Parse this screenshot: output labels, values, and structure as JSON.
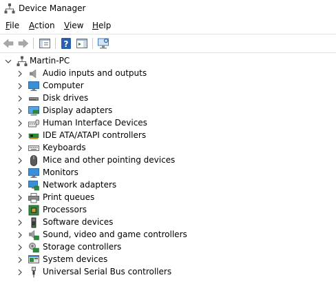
{
  "window": {
    "title": "Device Manager"
  },
  "menu": [
    {
      "key": "F",
      "rest": "ile"
    },
    {
      "key": "A",
      "rest": "ction"
    },
    {
      "key": "V",
      "rest": "iew"
    },
    {
      "key": "H",
      "rest": "elp"
    }
  ],
  "toolbar": {
    "buttons": [
      "back-icon",
      "forward-icon",
      "show-hide-tree-icon",
      "help-icon",
      "properties-pane-icon",
      "scan-hardware-icon"
    ]
  },
  "tree": {
    "root": {
      "label": "Martin-PC",
      "icon": "computer-root-icon",
      "expanded": true
    },
    "categories": [
      {
        "label": "Audio inputs and outputs",
        "icon": "speaker-icon"
      },
      {
        "label": "Computer",
        "icon": "monitor-icon"
      },
      {
        "label": "Disk drives",
        "icon": "disk-drive-icon"
      },
      {
        "label": "Display adapters",
        "icon": "display-adapter-icon"
      },
      {
        "label": "Human Interface Devices",
        "icon": "hid-icon"
      },
      {
        "label": "IDE ATA/ATAPI controllers",
        "icon": "ide-controller-icon"
      },
      {
        "label": "Keyboards",
        "icon": "keyboard-icon"
      },
      {
        "label": "Mice and other pointing devices",
        "icon": "mouse-icon"
      },
      {
        "label": "Monitors",
        "icon": "monitor-icon"
      },
      {
        "label": "Network adapters",
        "icon": "network-adapter-icon"
      },
      {
        "label": "Print queues",
        "icon": "printer-icon"
      },
      {
        "label": "Processors",
        "icon": "processor-icon"
      },
      {
        "label": "Software devices",
        "icon": "software-device-icon"
      },
      {
        "label": "Sound, video and game controllers",
        "icon": "sound-controller-icon"
      },
      {
        "label": "Storage controllers",
        "icon": "storage-controller-icon"
      },
      {
        "label": "System devices",
        "icon": "system-devices-icon"
      },
      {
        "label": "Universal Serial Bus controllers",
        "icon": "usb-icon"
      }
    ]
  },
  "colors": {
    "accent": "#1e6fd9",
    "separator": "#e3e3e3"
  }
}
